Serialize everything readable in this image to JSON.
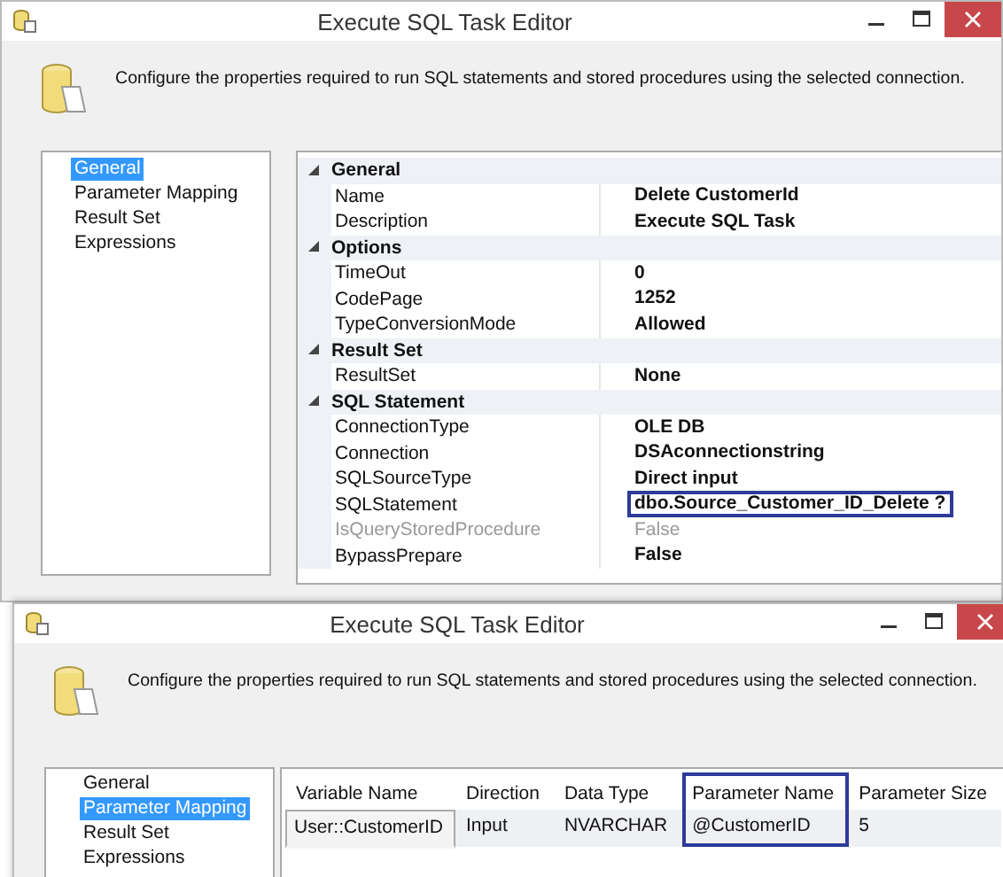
{
  "back_window": {
    "title": "Execute SQL Task Editor",
    "description": "Configure the properties required to run SQL statements and stored procedures using the selected connection.",
    "nav": [
      {
        "label": "General",
        "selected": true
      },
      {
        "label": "Parameter Mapping",
        "selected": false
      },
      {
        "label": "Result Set",
        "selected": false
      },
      {
        "label": "Expressions",
        "selected": false
      }
    ],
    "properties": [
      {
        "category": "General",
        "expanded": true,
        "rows": [
          {
            "name": "Name",
            "value": "Delete CustomerId",
            "disabled": false,
            "highlighted": false
          },
          {
            "name": "Description",
            "value": "Execute SQL Task",
            "disabled": false,
            "highlighted": false
          }
        ]
      },
      {
        "category": "Options",
        "expanded": true,
        "rows": [
          {
            "name": "TimeOut",
            "value": "0",
            "disabled": false,
            "highlighted": false
          },
          {
            "name": "CodePage",
            "value": "1252",
            "disabled": false,
            "highlighted": false
          },
          {
            "name": "TypeConversionMode",
            "value": "Allowed",
            "disabled": false,
            "highlighted": false
          }
        ]
      },
      {
        "category": "Result Set",
        "expanded": true,
        "rows": [
          {
            "name": "ResultSet",
            "value": "None",
            "disabled": false,
            "highlighted": false
          }
        ]
      },
      {
        "category": "SQL Statement",
        "expanded": true,
        "rows": [
          {
            "name": "ConnectionType",
            "value": "OLE DB",
            "disabled": false,
            "highlighted": false
          },
          {
            "name": "Connection",
            "value": "DSAconnectionstring",
            "disabled": false,
            "highlighted": false
          },
          {
            "name": "SQLSourceType",
            "value": "Direct input",
            "disabled": false,
            "highlighted": false
          },
          {
            "name": "SQLStatement",
            "value": "dbo.Source_Customer_ID_Delete ?",
            "disabled": false,
            "highlighted": true
          },
          {
            "name": "IsQueryStoredProcedure",
            "value": "False",
            "disabled": true,
            "highlighted": false
          },
          {
            "name": "BypassPrepare",
            "value": "False",
            "disabled": false,
            "highlighted": false
          }
        ]
      }
    ]
  },
  "front_window": {
    "title": "Execute SQL Task Editor",
    "description": "Configure the properties required to run SQL statements and stored procedures using the selected connection.",
    "nav": [
      {
        "label": "General",
        "selected": false
      },
      {
        "label": "Parameter Mapping",
        "selected": true
      },
      {
        "label": "Result Set",
        "selected": false
      },
      {
        "label": "Expressions",
        "selected": false
      }
    ],
    "mapping": {
      "columns": [
        {
          "label": "Variable Name",
          "highlighted": false
        },
        {
          "label": "Direction",
          "highlighted": false
        },
        {
          "label": "Data Type",
          "highlighted": false
        },
        {
          "label": "Parameter Name",
          "highlighted": true
        },
        {
          "label": "Parameter Size",
          "highlighted": false
        }
      ],
      "rows": [
        [
          "User::CustomerID",
          "Input",
          "NVARCHAR",
          "@CustomerID",
          "5"
        ]
      ]
    }
  }
}
